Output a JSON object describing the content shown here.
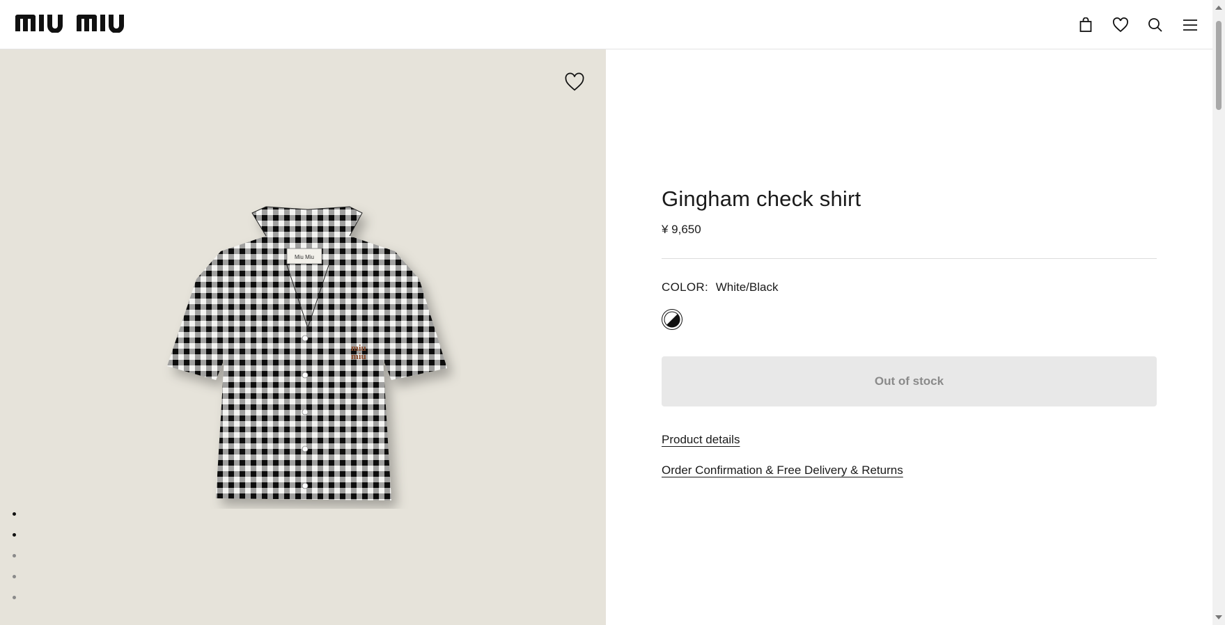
{
  "header": {
    "logo_text": "miu miu",
    "icons": [
      "bag-icon",
      "heart-icon",
      "search-icon",
      "menu-icon"
    ]
  },
  "gallery": {
    "wishlist_icon": "heart-icon",
    "image_alt": "Gingham check shirt",
    "dots_total": 5,
    "dots_active": [
      0,
      1
    ]
  },
  "product": {
    "title": "Gingham check shirt",
    "price": "¥ 9,650",
    "color_label": "COLOR:",
    "color_value": "White/Black",
    "stock_button": "Out of stock",
    "links": [
      "Product details",
      "Order Confirmation & Free Delivery & Returns"
    ]
  },
  "colors": {
    "gallery_bg": "#e6e3da",
    "button_bg": "#e8e8e8",
    "button_text": "#8a8a8a"
  }
}
